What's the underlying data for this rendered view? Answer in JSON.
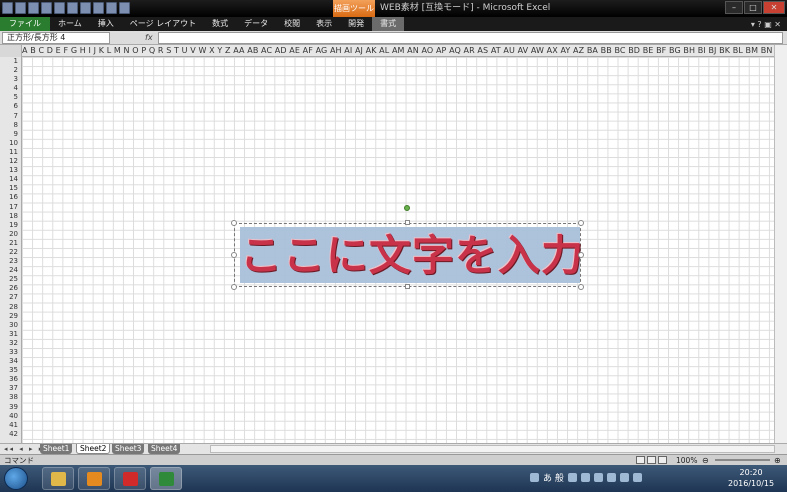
{
  "window": {
    "title": "WEB素材 [互換モード] - Microsoft Excel",
    "context_tool": "描画ツール",
    "min": "–",
    "max": "□",
    "close": "✕"
  },
  "ribbon": {
    "tabs": [
      "ファイル",
      "ホーム",
      "挿入",
      "ページ レイアウト",
      "数式",
      "データ",
      "校閲",
      "表示",
      "開発",
      "書式"
    ],
    "help": "▾ ? ▣ ✕"
  },
  "formula_bar": {
    "name_box": "正方形/長方形 4",
    "fx_label": "fx",
    "value": ""
  },
  "columns_text": "A B C D E F G H I J K L M N O P Q R S T U V W X Y Z AA AB AC AD AE AF AG AH AI AJ AK AL AM AN AO AP AQ AR AS AT AU AV AW AX AY AZ BA BB BC BD BE BF BG BH BI BJ BK BL BM BN BO BP",
  "rows": [
    "1",
    "2",
    "3",
    "4",
    "5",
    "6",
    "7",
    "8",
    "9",
    "10",
    "11",
    "12",
    "13",
    "14",
    "15",
    "16",
    "17",
    "18",
    "19",
    "20",
    "21",
    "22",
    "23",
    "24",
    "25",
    "26",
    "27",
    "28",
    "29",
    "30",
    "31",
    "32",
    "33",
    "34",
    "35",
    "36",
    "37",
    "38",
    "39",
    "40",
    "41",
    "42"
  ],
  "shape": {
    "text": "ここに文字を入力",
    "fill_color": "#a9bfd9",
    "text_color": "#c8334a"
  },
  "sheets": {
    "nav": "◂◂ ◂ ▸ ▸▸",
    "tabs": [
      "Sheet1",
      "Sheet2",
      "Sheet3",
      "Sheet4"
    ],
    "active": "Sheet2"
  },
  "status": {
    "mode": "コマンド",
    "zoom": "100%",
    "zoom_minus": "⊖",
    "zoom_plus": "⊕"
  },
  "taskbar": {
    "ime": "あ 般",
    "clock_time": "20:20",
    "clock_date": "2016/10/15"
  }
}
